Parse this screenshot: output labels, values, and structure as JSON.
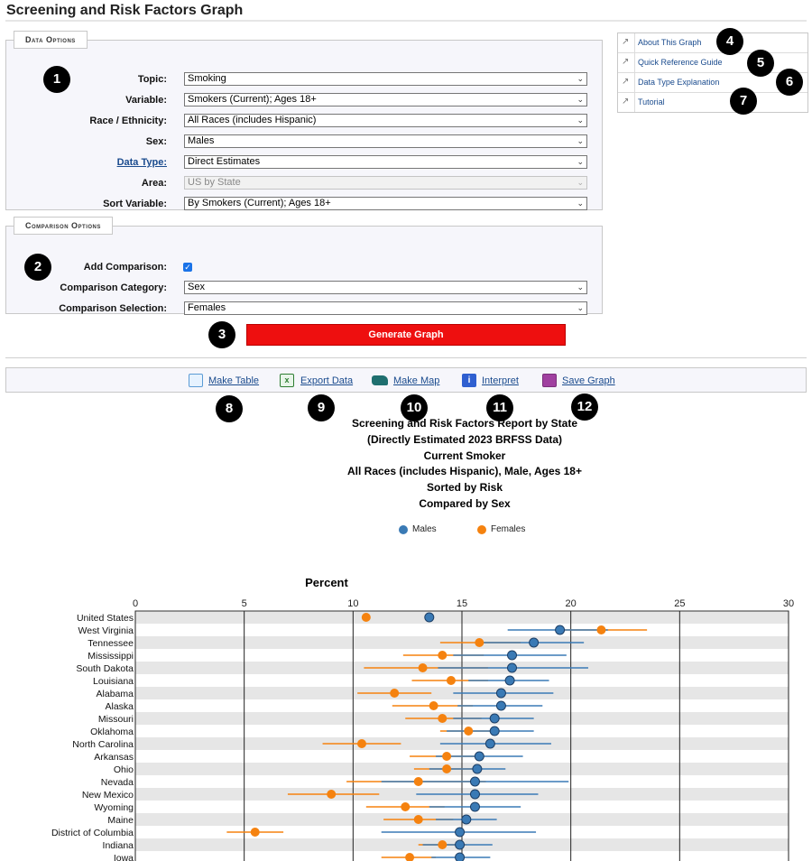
{
  "page_title": "Screening and Risk Factors Graph",
  "data_options": {
    "legend": "Data Options",
    "fields": [
      {
        "label": "Topic:",
        "value": "Smoking"
      },
      {
        "label": "Variable:",
        "value": "Smokers (Current); Ages 18+"
      },
      {
        "label": "Race / Ethnicity:",
        "value": "All Races (includes Hispanic)"
      },
      {
        "label": "Sex:",
        "value": "Males"
      },
      {
        "label": "Data Type:",
        "value": "Direct Estimates"
      },
      {
        "label": "Area:",
        "value": "US by State"
      },
      {
        "label": "Sort Variable:",
        "value": "By Smokers (Current); Ages 18+"
      }
    ]
  },
  "comparison_options": {
    "legend": "Comparison Options",
    "add_comparison_label": "Add Comparison:",
    "add_comparison_checked": true,
    "category_label": "Comparison Category:",
    "category_value": "Sex",
    "selection_label": "Comparison Selection:",
    "selection_value": "Females"
  },
  "generate_button": "Generate Graph",
  "right_links": [
    "About This Graph",
    "Quick Reference Guide",
    "Data Type Explanation",
    "Tutorial"
  ],
  "toolbar": [
    "Make Table",
    "Export Data",
    "Make Map",
    "Interpret",
    "Save Graph"
  ],
  "badges": [
    "1",
    "2",
    "3",
    "4",
    "5",
    "6",
    "7",
    "8",
    "9",
    "10",
    "11",
    "12"
  ],
  "report_title": [
    "Screening and Risk Factors Report by State",
    "(Directly Estimated 2023 BRFSS Data)",
    "Current Smoker",
    "All Races (includes Hispanic), Male, Ages 18+",
    "Sorted by Risk",
    "Compared by Sex"
  ],
  "colors": {
    "males": "#3a7ab5",
    "females": "#f5820f",
    "button": "#ee0f0f",
    "link": "#1a4b8e"
  },
  "chart_data": {
    "type": "scatter",
    "title": "Percent",
    "xlim": [
      0,
      30
    ],
    "xticks": [
      0,
      5,
      10,
      15,
      20,
      25,
      30
    ],
    "legend_position": "top",
    "series": [
      {
        "name": "Males",
        "color": "#3a7ab5",
        "values": [
          13.5,
          19.5,
          18.3,
          17.3,
          17.3,
          17.2,
          16.8,
          16.8,
          16.5,
          16.5,
          16.3,
          15.8,
          15.7,
          15.6,
          15.6,
          15.6,
          15.2,
          14.9,
          14.9,
          14.9
        ],
        "lower": [
          null,
          17.1,
          15.8,
          14.6,
          13.9,
          15.3,
          14.6,
          14.8,
          14.6,
          14.3,
          14.0,
          13.8,
          13.5,
          11.3,
          12.9,
          13.5,
          13.8,
          11.3,
          13.2,
          13.6
        ],
        "upper": [
          null,
          21.7,
          20.6,
          19.8,
          20.8,
          19.0,
          19.2,
          18.7,
          18.3,
          18.3,
          19.1,
          17.8,
          17.0,
          19.9,
          18.5,
          17.7,
          16.6,
          18.4,
          16.4,
          16.3
        ]
      },
      {
        "name": "Females",
        "color": "#f5820f",
        "values": [
          10.6,
          21.4,
          15.8,
          14.1,
          13.2,
          14.5,
          11.9,
          13.7,
          14.1,
          15.3,
          10.4,
          14.3,
          14.3,
          13.0,
          9.0,
          12.4,
          13.0,
          5.5,
          14.1,
          12.6
        ],
        "lower": [
          null,
          19.3,
          14.0,
          12.3,
          10.5,
          12.7,
          10.2,
          11.8,
          12.4,
          14.0,
          8.6,
          12.6,
          12.8,
          9.7,
          7.0,
          10.6,
          11.4,
          4.2,
          13.0,
          11.3
        ],
        "upper": [
          null,
          23.5,
          17.7,
          16.0,
          16.2,
          16.2,
          13.6,
          15.5,
          15.9,
          16.6,
          12.2,
          16.0,
          15.8,
          16.1,
          11.2,
          14.2,
          14.6,
          6.8,
          15.2,
          13.8
        ]
      }
    ],
    "categories": [
      "United States",
      "West Virginia",
      "Tennessee",
      "Mississippi",
      "South Dakota",
      "Louisiana",
      "Alabama",
      "Alaska",
      "Missouri",
      "Oklahoma",
      "North Carolina",
      "Arkansas",
      "Ohio",
      "Nevada",
      "New Mexico",
      "Wyoming",
      "Maine",
      "District of Columbia",
      "Indiana",
      "Iowa"
    ]
  }
}
